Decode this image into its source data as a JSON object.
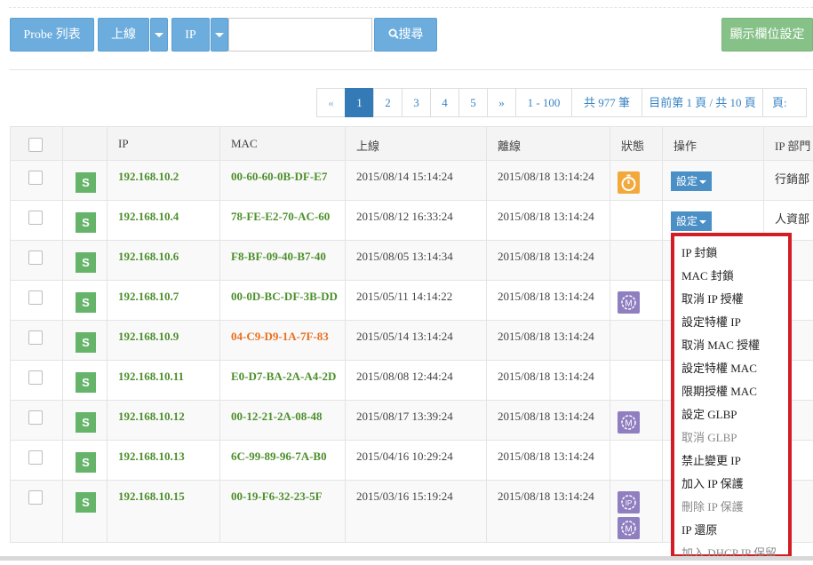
{
  "toolbar": {
    "probe_list": "Probe 列表",
    "online": "上線",
    "ip": "IP",
    "search_value": "",
    "search": "搜尋",
    "display_settings": "顯示欄位設定"
  },
  "pagination": {
    "prev": "«",
    "pages": [
      "1",
      "2",
      "3",
      "4",
      "5"
    ],
    "next": "»",
    "range": "1 - 100",
    "total": "共 977 筆",
    "current": "目前第 1 頁 / 共 10 頁",
    "page_label": "頁:"
  },
  "table": {
    "headers": [
      "",
      "",
      "IP",
      "MAC",
      "上線",
      "離線",
      "狀態",
      "操作",
      "IP 部門"
    ],
    "rows": [
      {
        "badge": "S",
        "ip": "192.168.10.2",
        "mac": "00-60-60-0B-DF-E7",
        "online": "2015/08/14 15:14:24",
        "offline": "2015/08/18 13:14:24",
        "action": "設定",
        "dept": "行銷部"
      },
      {
        "badge": "S",
        "ip": "192.168.10.4",
        "mac": "78-FE-E2-70-AC-60",
        "online": "2015/08/12 16:33:24",
        "offline": "2015/08/18 13:14:24",
        "action": "設定",
        "dept": "人資部"
      },
      {
        "badge": "S",
        "ip": "192.168.10.6",
        "mac": "F8-BF-09-40-B7-40",
        "online": "2015/08/05 13:14:34",
        "offline": "2015/08/18 13:14:24"
      },
      {
        "badge": "S",
        "ip": "192.168.10.7",
        "mac": "00-0D-BC-DF-3B-DD",
        "online": "2015/05/11 14:14:22",
        "offline": "2015/08/18 13:14:24"
      },
      {
        "badge": "S",
        "ip": "192.168.10.9",
        "mac": "04-C9-D9-1A-7F-83",
        "online": "2015/05/14 13:14:24",
        "offline": "2015/08/18 13:14:24"
      },
      {
        "badge": "S",
        "ip": "192.168.10.11",
        "mac": "E0-D7-BA-2A-A4-2D",
        "online": "2015/08/08 12:44:24",
        "offline": "2015/08/18 13:14:24"
      },
      {
        "badge": "S",
        "ip": "192.168.10.12",
        "mac": "00-12-21-2A-08-48",
        "online": "2015/08/17 13:39:24",
        "offline": "2015/08/18 13:14:24"
      },
      {
        "badge": "S",
        "ip": "192.168.10.13",
        "mac": "6C-99-89-96-7A-B0",
        "online": "2015/04/16 10:29:24",
        "offline": "2015/08/18 13:14:24"
      },
      {
        "badge": "S",
        "ip": "192.168.10.15",
        "mac": "00-19-F6-32-23-5F",
        "online": "2015/03/16 15:19:24",
        "offline": "2015/08/18 13:14:24"
      }
    ]
  },
  "dropdown": {
    "items": [
      "IP 封鎖",
      "MAC 封鎖",
      "取消 IP 授權",
      "設定特權 IP",
      "取消 MAC 授權",
      "設定特權 MAC",
      "限期授權 MAC",
      "設定 GLBP",
      "取消 GLBP",
      "禁止變更 IP",
      "加入 IP 保護",
      "刪除 IP 保護",
      "IP 還原",
      "加入 DHCP IP 保留"
    ]
  },
  "colors": {
    "primary_button": "#6caddd",
    "green_button": "#86c187",
    "ip_green": "#4d8f2c",
    "mac_orange": "#e8701f",
    "highlight_red": "#d21d24",
    "status_orange": "#f2a93b",
    "status_purple": "#8f7fc0"
  },
  "icons": {
    "search": "search-icon",
    "stopwatch": "stopwatch-icon",
    "mac_gear": "gear-m-icon",
    "ip_gear": "gear-ip-icon"
  }
}
